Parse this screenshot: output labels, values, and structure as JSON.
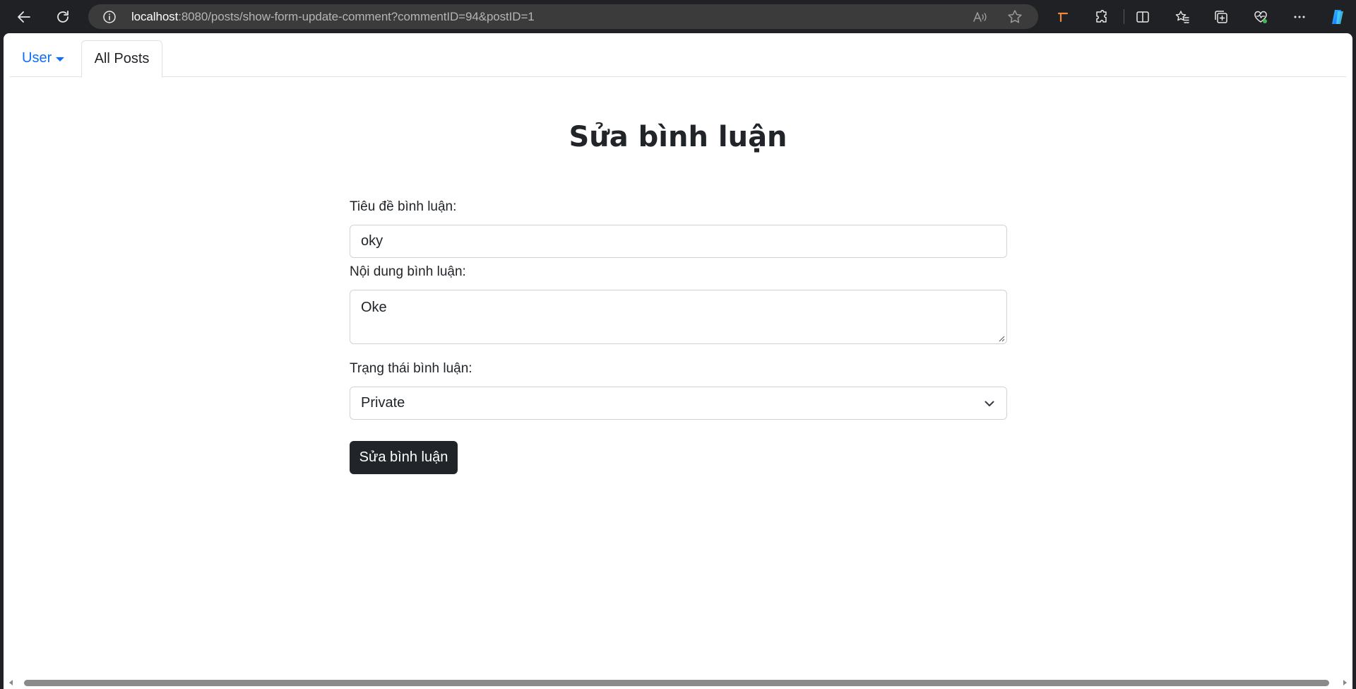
{
  "browser": {
    "url_host": "localhost",
    "url_rest": ":8080/posts/show-form-update-comment?commentID=94&postID=1"
  },
  "nav": {
    "user_label": "User",
    "all_posts_label": "All Posts"
  },
  "form": {
    "title": "Sửa bình luận",
    "title_label": "Tiêu đề bình luận:",
    "title_value": "oky",
    "content_label": "Nội dung bình luận:",
    "content_value": "Oke",
    "status_label": "Trạng thái bình luận:",
    "status_value": "Private",
    "submit_label": "Sửa bình luận"
  },
  "colors": {
    "accent": "#0d6efd",
    "button": "#212529",
    "chrome": "#202124"
  }
}
